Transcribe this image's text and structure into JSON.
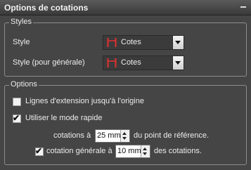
{
  "panel": {
    "title": "Options de cotations",
    "collapse_icon": "minus-icon"
  },
  "styles_group": {
    "legend": "Styles",
    "style_label": "Style",
    "style_value": "Cotes",
    "general_style_label": "Style (pour générale)",
    "general_style_value": "Cotes",
    "style_swatch_color": "#e23030"
  },
  "options_group": {
    "legend": "Options",
    "extension_lines_label": "Lignes d'extension jusqu'à l'origine",
    "extension_lines_checked": false,
    "quick_mode_label": "Utiliser le mode rapide",
    "quick_mode_checked": true,
    "cotations_prefix": "cotations à",
    "cotations_value": "25 mm",
    "cotations_suffix": "du point de référence.",
    "general_checked": true,
    "general_prefix": "cotation générale à",
    "general_value": "10 mm",
    "general_suffix": "des cotations."
  },
  "colors": {
    "panel_bg": "#454545",
    "group_border": "#8d8d8d",
    "text": "#ececec"
  }
}
